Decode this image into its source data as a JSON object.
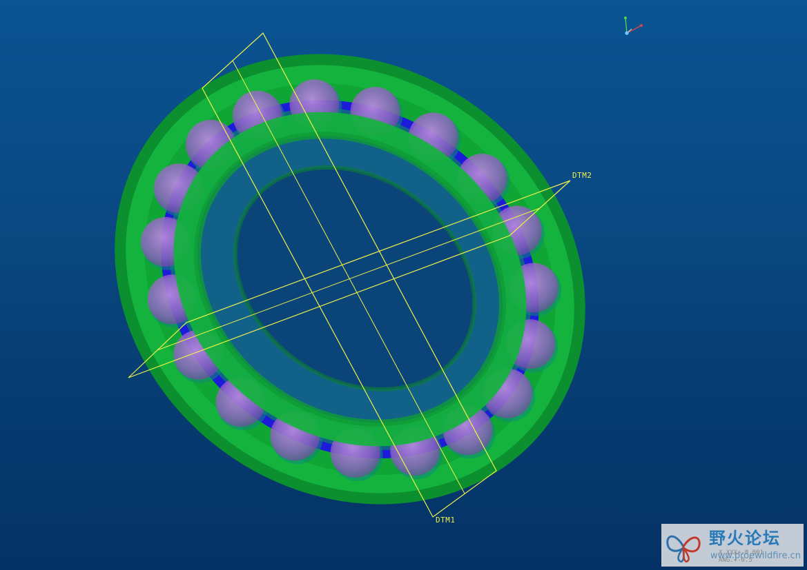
{
  "datums": {
    "dtm1_label": "DTM1",
    "dtm2_label": "DTM2"
  },
  "watermark": {
    "title": "野火论坛",
    "url": "www.proewildfire.cn",
    "tolerance_linear": "X.XXX+-0.001",
    "tolerance_angular": "ANG.+-0.5"
  },
  "colors": {
    "background_top": "#0b5392",
    "background_bottom": "#043266",
    "bearing_rings": "#0fbb3a",
    "balls": "#b26bd6",
    "raceway": "#1a1ae0",
    "datum_planes": "#f2f24a"
  },
  "icons": {
    "view_orientation": "coordinate-triad-icon",
    "watermark_logo": "butterfly-logo-icon"
  }
}
